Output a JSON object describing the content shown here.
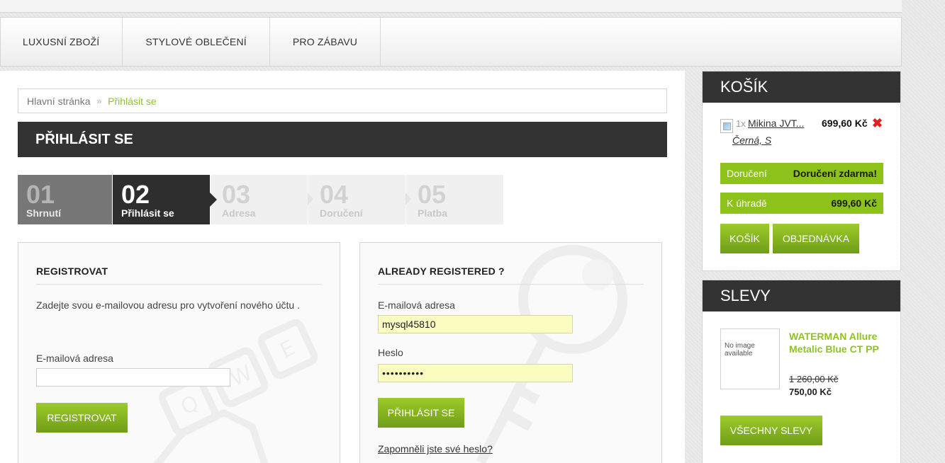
{
  "nav": {
    "items": [
      "LUXUSNÍ ZBOŽÍ",
      "STYLOVÉ OBLEČENÍ",
      "PRO ZÁBAVU"
    ]
  },
  "breadcrumb": {
    "home": "Hlavní stránka",
    "separator": "»",
    "current": "Přihlásit se"
  },
  "page_title": "PŘIHLÁSIT SE",
  "steps": [
    {
      "num": "01",
      "label": "Shrnutí"
    },
    {
      "num": "02",
      "label": "Přihlásit se"
    },
    {
      "num": "03",
      "label": "Adresa"
    },
    {
      "num": "04",
      "label": "Doručení"
    },
    {
      "num": "05",
      "label": "Platba"
    }
  ],
  "register": {
    "heading": "REGISTROVAT",
    "description": "Zadejte svou e-mailovou adresu pro vytvoření nového účtu .",
    "email_label": "E-mailová adresa",
    "email_value": "",
    "button": "REGISTROVAT"
  },
  "login": {
    "heading": "ALREADY REGISTERED ?",
    "email_label": "E-mailová adresa",
    "email_value": "mysql45810",
    "password_label": "Heslo",
    "password_value": "••••••••••",
    "button": "PŘIHLÁSIT SE",
    "forgot": "Zapomněli jste své heslo?"
  },
  "cart": {
    "title": "KOŠÍK",
    "item": {
      "qty": "1x",
      "name": "Mikina JVT...",
      "variant": "Černá, S",
      "price": "699,60 Kč"
    },
    "shipping_label": "Doručení",
    "shipping_value": "Doručení zdarma!",
    "total_label": "K úhradě",
    "total_value": "699,60 Kč",
    "cart_button": "KOŠÍK",
    "order_button": "OBJEDNÁVKA"
  },
  "sales": {
    "title": "SLEVY",
    "no_image": "No image available",
    "product_name": "WATERMAN Allure Metalic Blue CT PP",
    "old_price": "1 260,00 Kč",
    "new_price": "750,00 Kč",
    "all_button": "VŠECHNY SLEVY"
  },
  "colors": {
    "accent_green": "#8cc21a",
    "dark_header": "#333333",
    "input_autofill": "#fafcc0"
  }
}
